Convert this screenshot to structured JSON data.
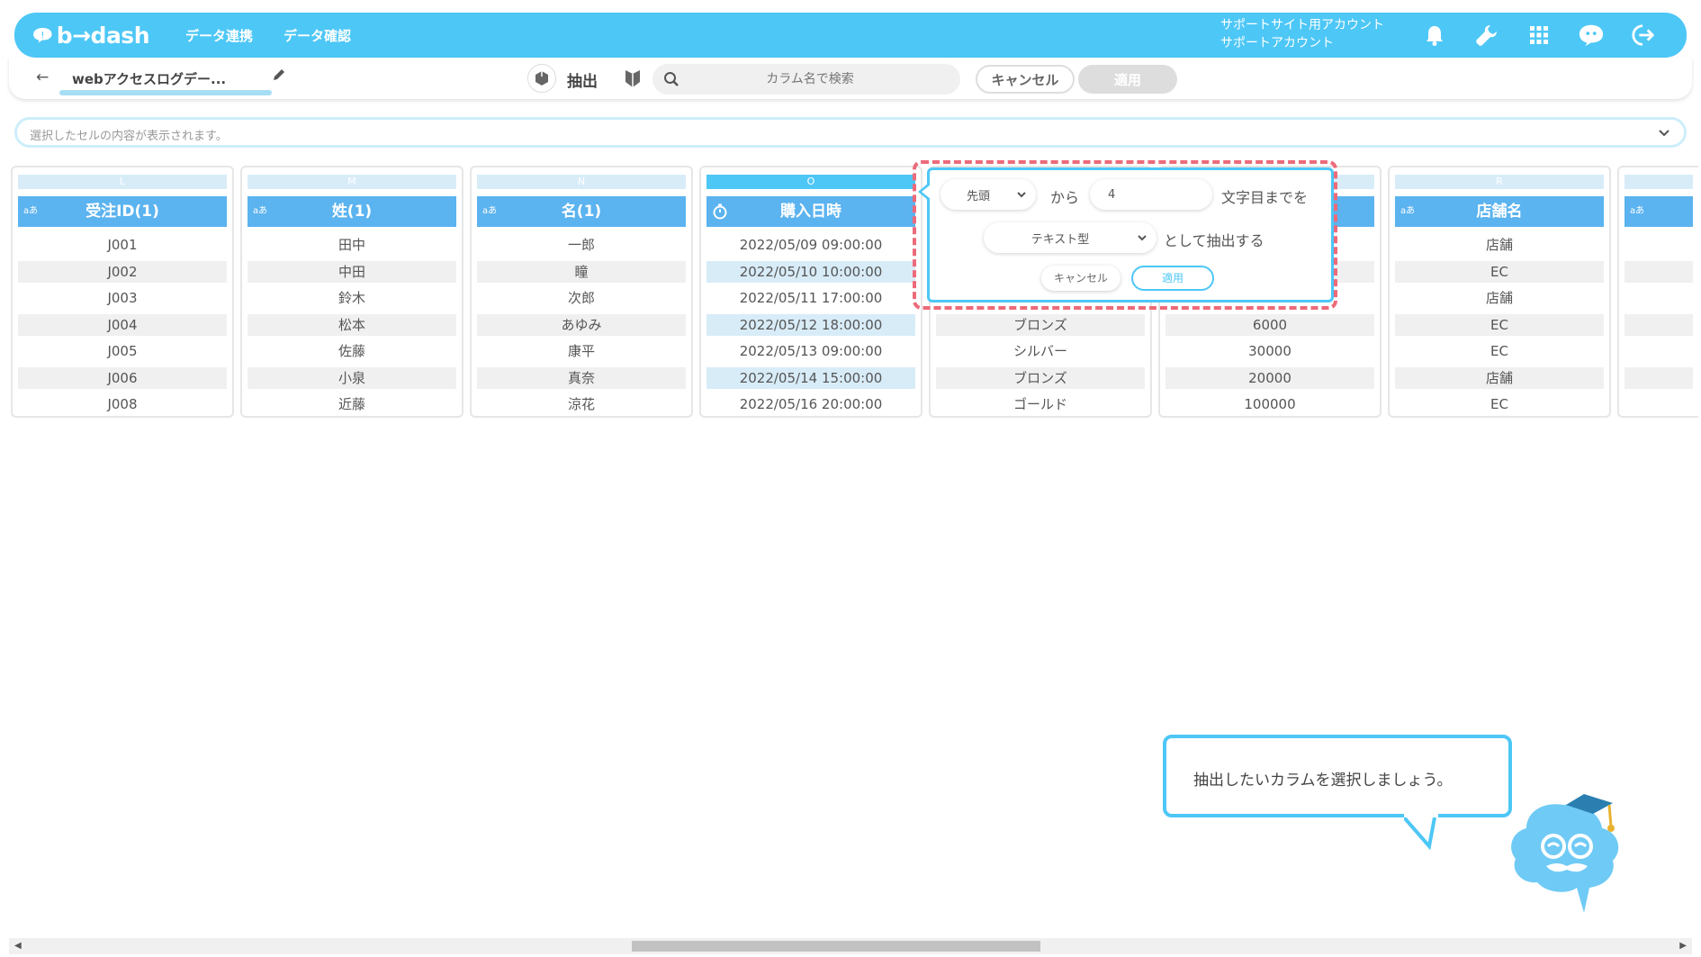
{
  "header": {
    "logo_text": "b→dash",
    "nav": [
      "データ連携",
      "データ確認"
    ],
    "account_line1": "サポートサイト用アカウント",
    "account_line2": "サポートアカウント",
    "icons": [
      "bell-icon",
      "wrench-icon",
      "grid-icon",
      "chat-icon",
      "logout-icon"
    ]
  },
  "toolbar": {
    "back": "←",
    "dataset_name": "webアクセスログデー...",
    "operation_label": "抽出",
    "search_placeholder": "カラム名で検索",
    "cancel_label": "キャンセル",
    "apply_label": "適用"
  },
  "cellbar": {
    "placeholder": "選択したセルの内容が表示されます。"
  },
  "columns": [
    {
      "letter": "L",
      "type": "aあ",
      "name": "受注ID(1)",
      "cells": [
        "J001",
        "J002",
        "J003",
        "J004",
        "J005",
        "J006",
        "J008"
      ]
    },
    {
      "letter": "M",
      "type": "aあ",
      "name": "姓(1)",
      "cells": [
        "田中",
        "中田",
        "鈴木",
        "松本",
        "佐藤",
        "小泉",
        "近藤"
      ]
    },
    {
      "letter": "N",
      "type": "aあ",
      "name": "名(1)",
      "cells": [
        "一郎",
        "瞳",
        "次郎",
        "あゆみ",
        "康平",
        "真奈",
        "涼花"
      ]
    },
    {
      "letter": "O",
      "type": "clock",
      "name": "購入日時",
      "cells": [
        "2022/05/09 09:00:00",
        "2022/05/10 10:00:00",
        "2022/05/11 17:00:00",
        "2022/05/12 18:00:00",
        "2022/05/13 09:00:00",
        "2022/05/14 15:00:00",
        "2022/05/16 20:00:00"
      ]
    },
    {
      "letter": "",
      "type": "",
      "name": "",
      "cells": [
        "",
        "",
        "",
        "ブロンズ",
        "シルバー",
        "ブロンズ",
        "ゴールド"
      ]
    },
    {
      "letter": "",
      "type": "",
      "name": "",
      "cells": [
        "",
        "",
        "",
        "6000",
        "30000",
        "20000",
        "100000"
      ]
    },
    {
      "letter": "R",
      "type": "aあ",
      "name": "店舗名",
      "cells": [
        "店舗",
        "EC",
        "店舗",
        "EC",
        "EC",
        "店舗",
        "EC"
      ]
    },
    {
      "letter": "",
      "type": "aあ",
      "name": "",
      "cells": [
        "",
        "",
        "",
        "",
        "",
        "",
        ""
      ]
    }
  ],
  "popup": {
    "position_value": "先頭",
    "from_text": "から",
    "count_value": "4",
    "chars_text": "文字目までを",
    "type_value": "テキスト型",
    "extract_text": "として抽出する",
    "cancel_label": "キャンセル",
    "apply_label": "適用"
  },
  "tip": {
    "message": "抽出したいカラムを選択しましょう。"
  },
  "colors": {
    "accent": "#4dc7f6",
    "header_blue": "#5bb3ef",
    "highlight": "#ec6a7a"
  }
}
